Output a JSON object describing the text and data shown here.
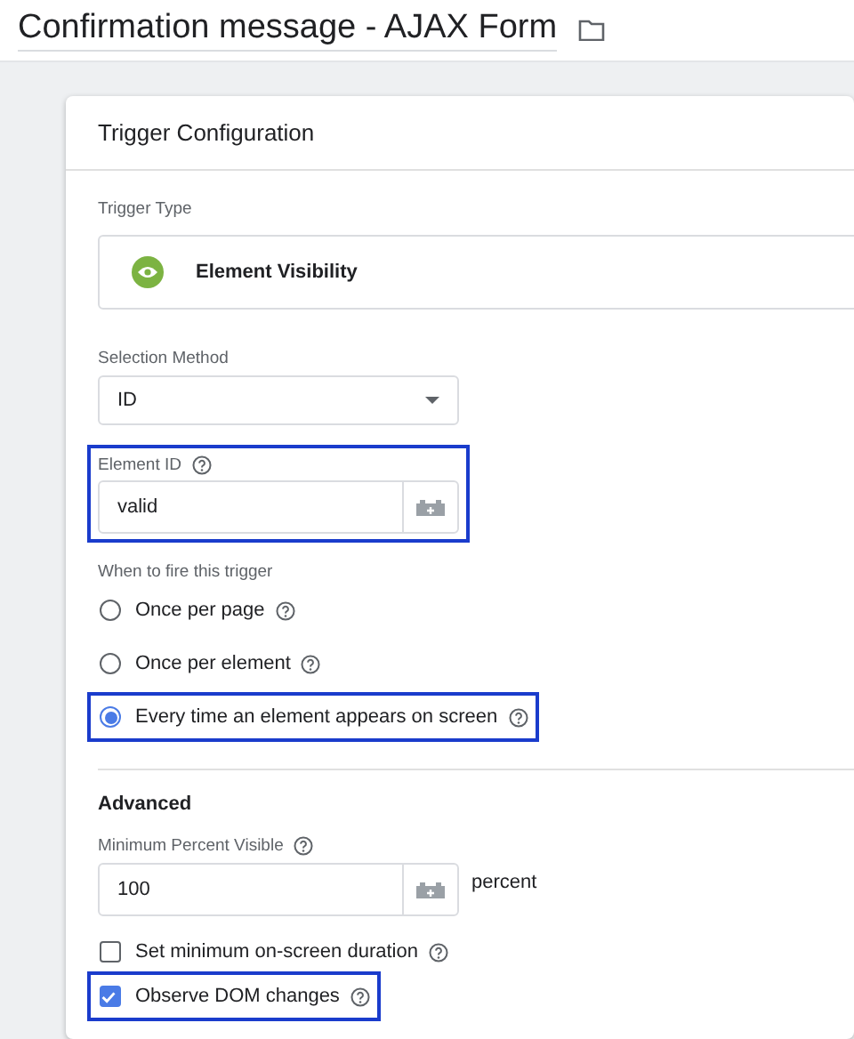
{
  "header": {
    "title": "Confirmation message - AJAX Form"
  },
  "card": {
    "title": "Trigger Configuration",
    "trigger_type": {
      "label": "Trigger Type",
      "value": "Element Visibility"
    },
    "selection_method": {
      "label": "Selection Method",
      "value": "ID"
    },
    "element_id": {
      "label": "Element ID",
      "value": "valid",
      "highlighted": true
    },
    "fire": {
      "label": "When to fire this trigger",
      "options": [
        {
          "label": "Once per page",
          "selected": false,
          "highlighted": false
        },
        {
          "label": "Once per element",
          "selected": false,
          "highlighted": false
        },
        {
          "label": "Every time an element appears on screen",
          "selected": true,
          "highlighted": true
        }
      ]
    },
    "advanced": {
      "title": "Advanced",
      "min_percent": {
        "label": "Minimum Percent Visible",
        "value": "100",
        "unit": "percent"
      },
      "checkboxes": [
        {
          "label": "Set minimum on-screen duration",
          "checked": false,
          "highlighted": false
        },
        {
          "label": "Observe DOM changes",
          "checked": true,
          "highlighted": true
        }
      ]
    }
  }
}
